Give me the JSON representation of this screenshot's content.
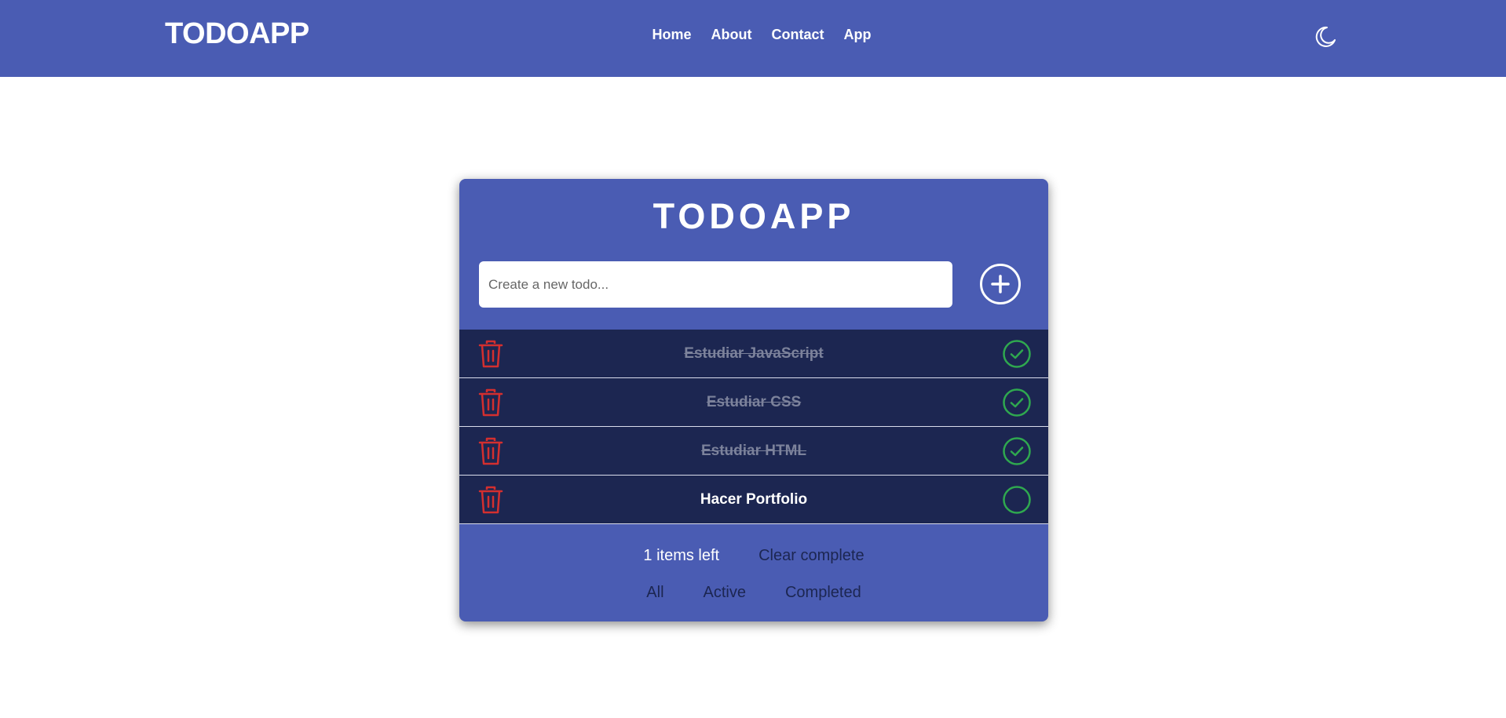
{
  "navbar": {
    "brand": "TODOAPP",
    "links": [
      "Home",
      "About",
      "Contact",
      "App"
    ],
    "theme_icon": "moon-icon"
  },
  "card": {
    "title": "TODOAPP",
    "input_placeholder": "Create a new todo...",
    "add_icon": "plus-circle-icon"
  },
  "todos": [
    {
      "text": "Estudiar JavaScript",
      "completed": true
    },
    {
      "text": "Estudiar CSS",
      "completed": true
    },
    {
      "text": "Estudiar HTML",
      "completed": true
    },
    {
      "text": "Hacer Portfolio",
      "completed": false
    }
  ],
  "footer": {
    "items_left": "1 items left",
    "clear_complete": "Clear complete",
    "filters": [
      "All",
      "Active",
      "Completed"
    ]
  },
  "colors": {
    "primary": "#4a5cb3",
    "item_bg": "#1c2651",
    "trash": "#d32f2f",
    "check": "#2fa84f"
  }
}
